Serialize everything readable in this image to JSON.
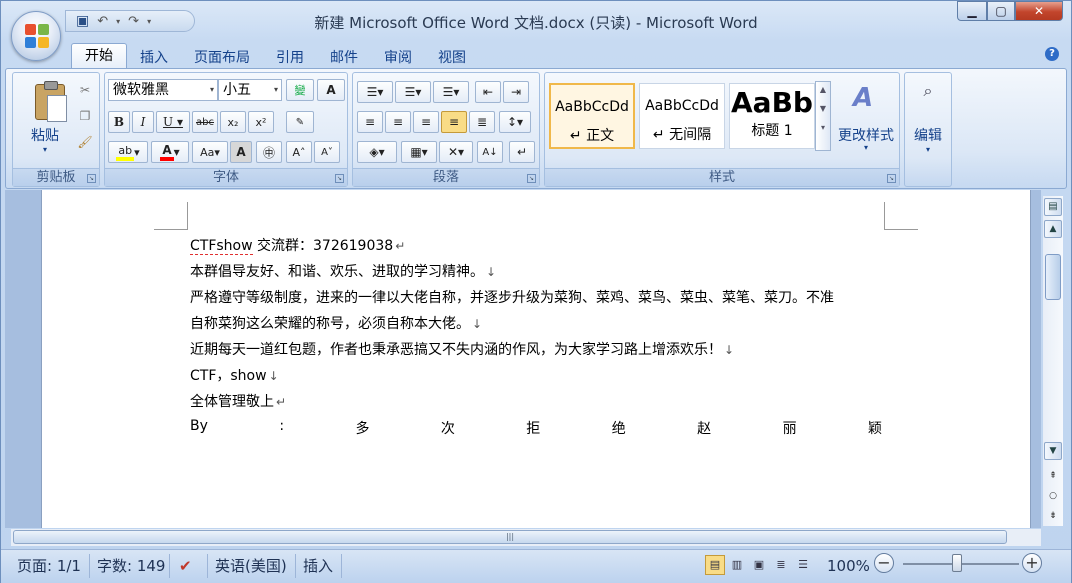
{
  "window": {
    "title": "新建 Microsoft Office Word 文档.docx (只读) - Microsoft Word"
  },
  "tabs": [
    "开始",
    "插入",
    "页面布局",
    "引用",
    "邮件",
    "审阅",
    "视图"
  ],
  "ribbon": {
    "clipboard": {
      "label": "剪贴板",
      "paste": "粘贴"
    },
    "font": {
      "label": "字体",
      "font_name": "微软雅黑",
      "font_size": "小五"
    },
    "paragraph": {
      "label": "段落"
    },
    "styles": {
      "label": "样式",
      "items": [
        {
          "sample": "AaBbCcDd",
          "name": "↵ 正文"
        },
        {
          "sample": "AaBbCcDd",
          "name": "↵ 无间隔"
        },
        {
          "sample": "AaBb",
          "name": "标题 1"
        }
      ],
      "change_styles": "更改样式"
    },
    "editing": {
      "label": "编辑"
    }
  },
  "document": {
    "lines": [
      "交流群：372619038",
      "本群倡导友好、和谐、欢乐、进取的学习精神。",
      "严格遵守等级制度，进来的一律以大佬自称，并逐步升级为菜狗、菜鸡、菜鸟、菜虫、菜笔、菜刀。不准",
      "自称菜狗这么荣耀的称号，必须自称本大佬。",
      "近期每天一道红包题，作者也秉承恶搞又不失内涵的作风，为大家学习路上增添欢乐！",
      "CTF，show",
      "全体管理敬上"
    ],
    "first_word": "CTFshow",
    "byline": [
      "By",
      ":",
      "多",
      "次",
      "拒",
      "绝",
      "赵",
      "丽",
      "颖"
    ]
  },
  "status": {
    "page": "页面: 1/1",
    "words": "字数: 149",
    "language": "英语(美国)",
    "mode": "插入",
    "zoom": "100%"
  },
  "colors": {
    "highlight": "#ffff00",
    "font_color": "#ff0000",
    "ribbon_text": "#15428b"
  }
}
